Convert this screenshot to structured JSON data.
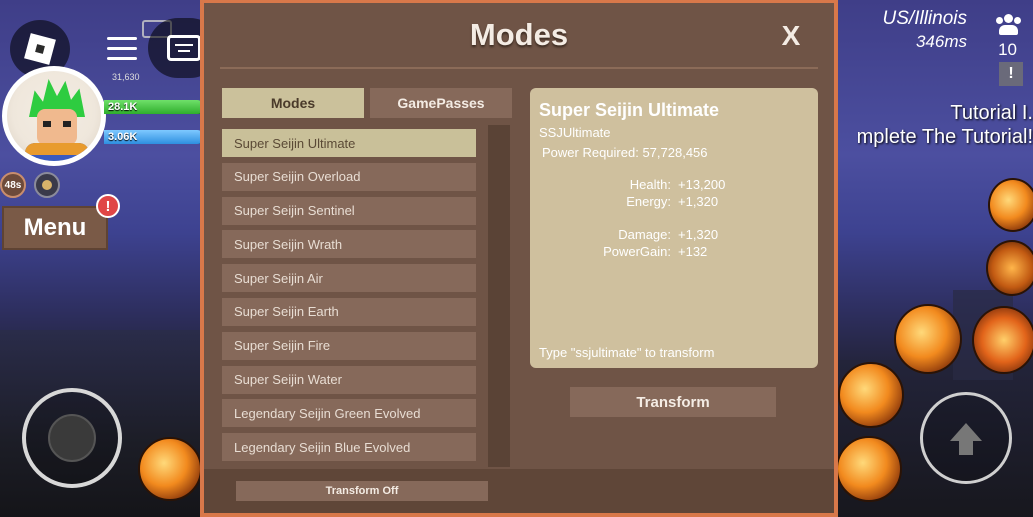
{
  "hud": {
    "level_text": "31,630",
    "health_value": "28.1K",
    "energy_value": "3.06K",
    "cooldown_badge": "48s",
    "menu_label": "Menu",
    "alert_mark": "!",
    "server_region": "US/Illinois",
    "server_ping": "346ms",
    "player_count": "10",
    "warning_mark": "!",
    "tutorial_title": "Tutorial I.",
    "tutorial_subtitle": "mplete The Tutorial!"
  },
  "modal": {
    "title": "Modes",
    "close_label": "X",
    "tabs": [
      {
        "label": "Modes",
        "active": true
      },
      {
        "label": "GamePasses",
        "active": false
      }
    ],
    "modes": [
      "Super Seijin Ultimate",
      "Super Seijin Overload",
      "Super Seijin Sentinel",
      "Super Seijin Wrath",
      "Super Seijin Air",
      "Super Seijin Earth",
      "Super Seijin Fire",
      "Super Seijin Water",
      "Legendary Seijin Green Evolved",
      "Legendary Seijin Blue Evolved"
    ],
    "selected_index": 0,
    "details": {
      "name": "Super Seijin Ultimate",
      "code": "SSJUltimate",
      "power_required": "Power Required: 57,728,456",
      "stats": [
        {
          "label": "Health:",
          "value": "+13,200"
        },
        {
          "label": "Energy:",
          "value": "+1,320"
        },
        {
          "label": "Damage:",
          "value": "+1,320"
        },
        {
          "label": "PowerGain:",
          "value": "+132"
        }
      ],
      "hint": "Type \"ssjultimate\" to transform"
    },
    "transform_label": "Transform",
    "transform_off_label": "Transform Off"
  },
  "colors": {
    "modal_bg": "#6f5446",
    "modal_border": "#d8784a",
    "tab_active": "#cbc19b",
    "item_bg": "#86695a",
    "detail_bg": "#cfc09e"
  }
}
